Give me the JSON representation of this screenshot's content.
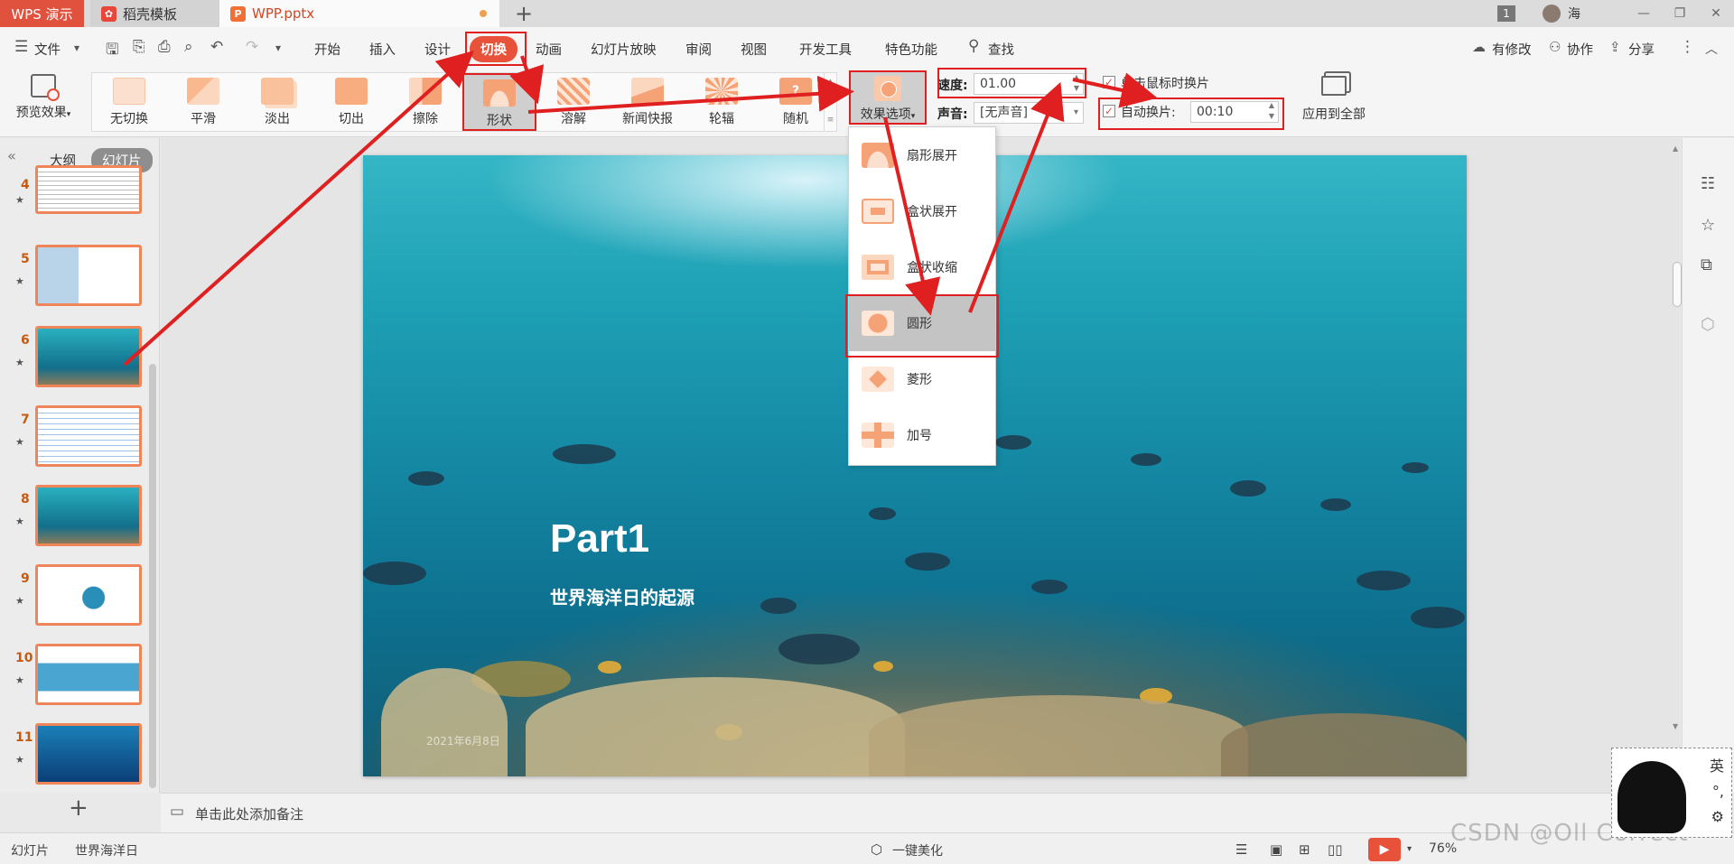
{
  "tabs": {
    "app": "WPS 演示",
    "template": "稻壳模板",
    "file": "WPP.pptx",
    "new_tab": "+"
  },
  "window": {
    "badge": "1",
    "user": "海"
  },
  "menu": {
    "file": "文件",
    "items": [
      "开始",
      "插入",
      "设计",
      "切换",
      "动画",
      "幻灯片放映",
      "审阅",
      "视图",
      "开发工具",
      "特色功能"
    ],
    "search": "查找",
    "right": [
      "有修改",
      "协作",
      "分享"
    ]
  },
  "ribbon": {
    "preview": "预览效果",
    "effects": [
      "无切换",
      "平滑",
      "淡出",
      "切出",
      "擦除",
      "形状",
      "溶解",
      "新闻快报",
      "轮辐",
      "随机"
    ],
    "effect_options": "效果选项",
    "speed_label": "速度:",
    "speed_value": "01.00",
    "sound_label": "声音:",
    "sound_value": "[无声音]",
    "click_advance": "单击鼠标时换片",
    "auto_advance": "自动换片:",
    "auto_value": "00:10",
    "apply_all": "应用到全部"
  },
  "dropdown": {
    "items": [
      "扇形展开",
      "盒状展开",
      "盒状收缩",
      "圆形",
      "菱形",
      "加号"
    ],
    "selected": "圆形"
  },
  "left_panel": {
    "tab_outline": "大纲",
    "tab_slides": "幻灯片",
    "slide_numbers": [
      "4",
      "5",
      "6",
      "7",
      "8",
      "9",
      "10",
      "11"
    ],
    "add": "+"
  },
  "slide": {
    "title": "Part1",
    "subtitle": "世界海洋日的起源",
    "footer": "2021年6月8日"
  },
  "notes": {
    "placeholder": "单击此处添加备注"
  },
  "status": {
    "view": "幻灯片",
    "theme": "世界海洋日",
    "beautify": "一键美化",
    "zoom": "76%",
    "watermark": "CSDN @Oll Correct"
  },
  "ime": {
    "lang": "英"
  },
  "colors": {
    "accent": "#e8523a",
    "highlight_red": "#e02020"
  }
}
